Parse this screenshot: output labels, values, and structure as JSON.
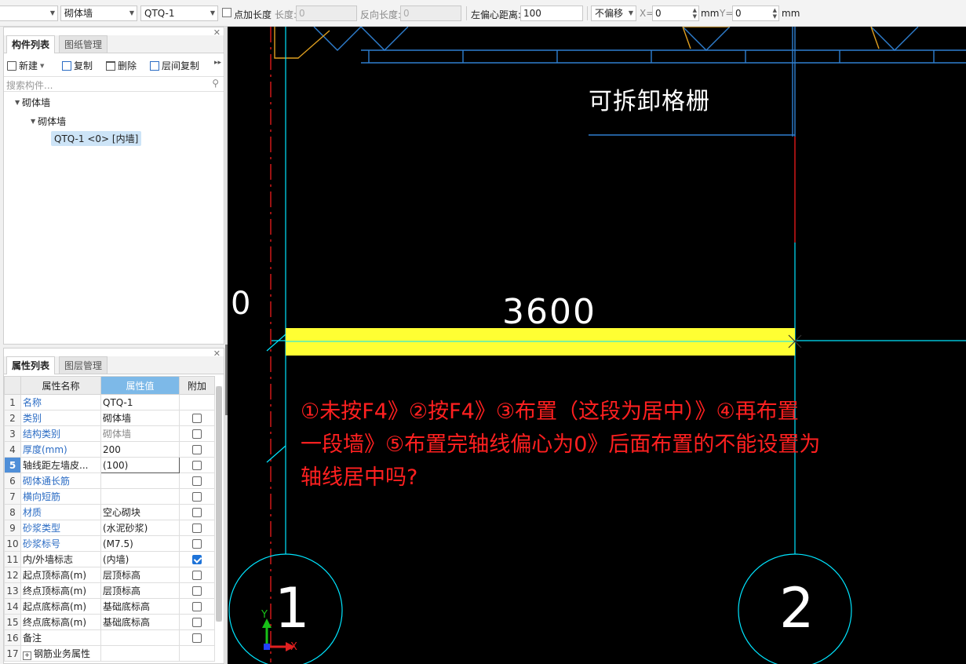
{
  "toolbar": {
    "type_value": "砌体墙",
    "name_value": "QTQ-1",
    "point_length_label": "点加长度",
    "length_label": "长度:",
    "length_value": "0",
    "reverse_length_label": "反向长度:",
    "reverse_length_value": "0",
    "left_offset_label": "左偏心距离:",
    "left_offset_value": "100",
    "offset_mode": "不偏移",
    "x_label": "X=",
    "x_value": "0",
    "x_unit": "mm",
    "y_label": "Y=",
    "y_value": "0",
    "y_unit": "mm"
  },
  "component_panel": {
    "tabs": [
      "构件列表",
      "图纸管理"
    ],
    "actions": {
      "new": "新建",
      "copy": "复制",
      "delete": "删除",
      "floor_copy": "层间复制",
      "more": "▸▸"
    },
    "search_placeholder": "搜索构件...",
    "tree": {
      "root": "砌体墙",
      "child": "砌体墙",
      "leaf": "QTQ-1 <0> [内墙]"
    }
  },
  "property_panel": {
    "tabs": [
      "属性列表",
      "图层管理"
    ],
    "headers": [
      "属性名称",
      "属性值",
      "附加"
    ],
    "rows": [
      {
        "num": "1",
        "name": "名称",
        "value": "QTQ-1"
      },
      {
        "num": "2",
        "name": "类别",
        "value": "砌体墙"
      },
      {
        "num": "3",
        "name": "结构类别",
        "value": "砌体墙"
      },
      {
        "num": "4",
        "name": "厚度(mm)",
        "value": "200"
      },
      {
        "num": "5",
        "name": "轴线距左墙皮...",
        "value": "(100)"
      },
      {
        "num": "6",
        "name": "砌体通长筋",
        "value": ""
      },
      {
        "num": "7",
        "name": "横向短筋",
        "value": ""
      },
      {
        "num": "8",
        "name": "材质",
        "value": "空心砌块"
      },
      {
        "num": "9",
        "name": "砂浆类型",
        "value": "(水泥砂浆)"
      },
      {
        "num": "10",
        "name": "砂浆标号",
        "value": "(M7.5)"
      },
      {
        "num": "11",
        "name": "内/外墙标志",
        "value": "(内墙)"
      },
      {
        "num": "12",
        "name": "起点顶标高(m)",
        "value": "层顶标高"
      },
      {
        "num": "13",
        "name": "终点顶标高(m)",
        "value": "层顶标高"
      },
      {
        "num": "14",
        "name": "起点底标高(m)",
        "value": "基础底标高"
      },
      {
        "num": "15",
        "name": "终点底标高(m)",
        "value": "基础底标高"
      },
      {
        "num": "16",
        "name": "备注",
        "value": ""
      },
      {
        "num": "17",
        "name": "钢筋业务属性",
        "value": ""
      }
    ]
  },
  "canvas": {
    "label_grille": "可拆卸格栅",
    "dimension": "3600",
    "left_edge_digit": "0",
    "axis_1": "1",
    "axis_2": "2",
    "ucs_y": "Y",
    "ucs_x": "X",
    "wall_color": "#ffff33",
    "axis_color": "#00e5ff",
    "annotation_color": "#ff2020",
    "annotation_lines": [
      "①未按F4》②按F4》③布置（这段为居中）》④再布置",
      "一段墙》⑤布置完轴线偏心为0》后面布置的不能设置为",
      "轴线居中吗?"
    ]
  }
}
